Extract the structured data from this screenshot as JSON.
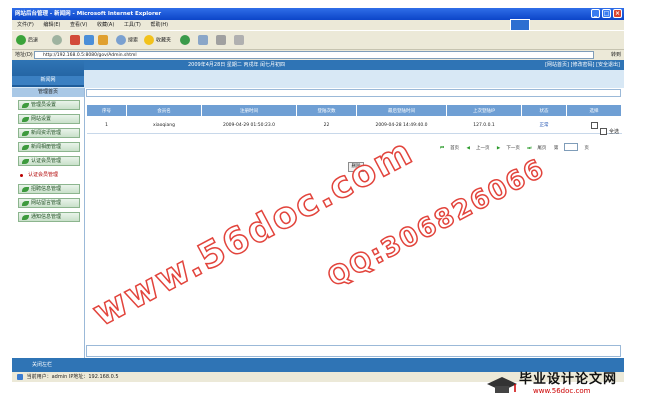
{
  "window": {
    "title": "网站后台管理 - 新闻网 - Microsoft Internet Explorer",
    "buttons": [
      "_",
      "□",
      "×"
    ]
  },
  "menu": [
    "文件(F)",
    "编辑(E)",
    "查看(V)",
    "收藏(A)",
    "工具(T)",
    "帮助(H)"
  ],
  "toolbar": {
    "back": "后退",
    "search": "搜索",
    "favorites": "收藏夹"
  },
  "address": {
    "label": "地址(D)",
    "url": "http://192.168.0.5:8080/gov/Admin.shtml",
    "go": "转到"
  },
  "header": {
    "site_name": "新闻网",
    "date_text": "2009年4月28日 星期二 丙戌年 闰七月初四",
    "links": [
      "[网站首页]",
      "[修改密码]",
      "[安全退出]"
    ]
  },
  "sidebar": {
    "head": "管理首页",
    "items": [
      {
        "label": "管理员设置",
        "style": "button"
      },
      {
        "label": "网站设置",
        "style": "button"
      },
      {
        "label": "新闻资讯管理",
        "style": "button"
      },
      {
        "label": "新闻相册管理",
        "style": "button"
      },
      {
        "label": "认证会员管理",
        "style": "button"
      },
      {
        "label": "认证会员管理",
        "style": "plain"
      },
      {
        "label": "招聘信息管理",
        "style": "button"
      },
      {
        "label": "网站留言管理",
        "style": "button"
      },
      {
        "label": "通知信息管理",
        "style": "button"
      }
    ]
  },
  "table": {
    "headers": [
      "序号",
      "会员名",
      "注册时间",
      "登陆次数",
      "最后登陆时间",
      "上次登陆IP",
      "状态",
      "选择"
    ],
    "rows": [
      {
        "no": "1",
        "name": "xiaoqiang",
        "reg_time": "2009-04-29 01:50:23.0",
        "logins": "22",
        "last_time": "2009-04-28 14:49:40.0",
        "last_ip": "127.0.0.1",
        "status": "正常"
      }
    ],
    "select_all": "全选"
  },
  "pager": {
    "first": "首页",
    "prev": "上一页",
    "next": "下一页",
    "last": "尾页",
    "page_label": "第",
    "page_suffix": "页"
  },
  "delete_button": "删除",
  "footer": {
    "text": "关闭左栏"
  },
  "status": {
    "text": "当前用户：admin  IP地址：192.168.0.5"
  },
  "watermarks": {
    "site": "www.56doc.com",
    "qq": "QQ:306826066",
    "badge_title": "毕业设计论文网",
    "badge_url": "www.56doc.com"
  },
  "colors": {
    "header_blue": "#2f74b5",
    "watermark_red": "#e2443c",
    "xp_title": "#0c45c8"
  }
}
